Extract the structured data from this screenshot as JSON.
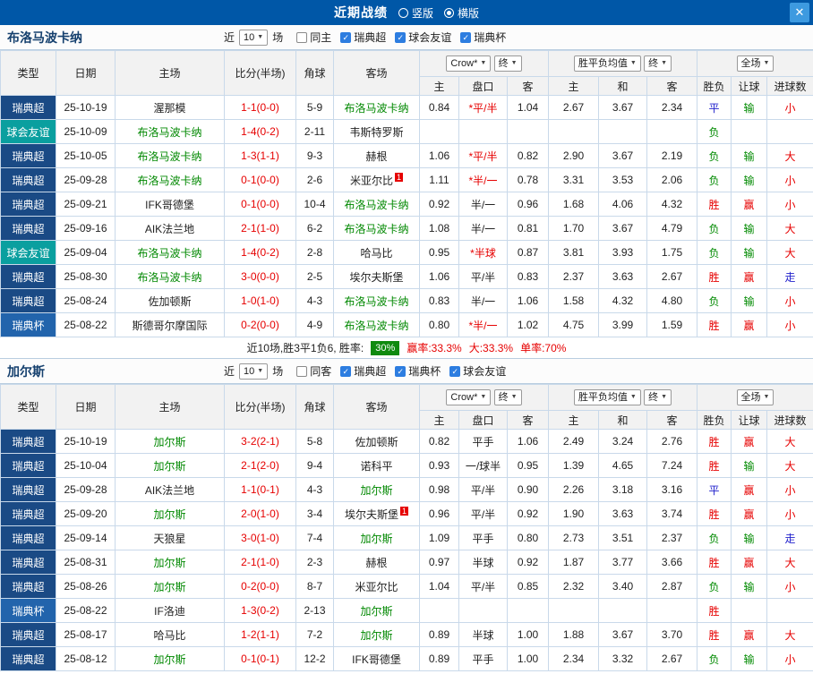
{
  "topbar": {
    "title": "近期战绩",
    "radio_vertical": "竖版",
    "radio_horizontal": "横版",
    "selected": "横版",
    "close_icon": "✕"
  },
  "table_headers": {
    "type": "类型",
    "date": "日期",
    "home": "主场",
    "score": "比分(半场)",
    "corner": "角球",
    "away": "客场",
    "odds_provider": "Crow*",
    "final": "终",
    "avg_label": "胜平负均值",
    "full_match": "全场",
    "sub": [
      "主",
      "盘口",
      "客",
      "主",
      "和",
      "客",
      "胜负",
      "让球",
      "进球数"
    ]
  },
  "colors": {
    "topbar_blue": "#0057a7",
    "league_navy": "#1a4a85",
    "friendly_teal": "#0a9f9f",
    "cup_blue": "#2264ac",
    "win_red": "#e60000",
    "lose_green": "#008a00",
    "draw_blue": "#2222cc",
    "badge_green": "#0f8a0f"
  },
  "sections": [
    {
      "team": "布洛马波卡纳",
      "near_label": "近",
      "games_count": "10",
      "games_label": "场",
      "filters": [
        {
          "label": "同主",
          "checked": false
        },
        {
          "label": "瑞典超",
          "checked": true
        },
        {
          "label": "球会友谊",
          "checked": true
        },
        {
          "label": "瑞典杯",
          "checked": true
        }
      ],
      "rows": [
        {
          "type": "瑞典超",
          "tc": "league",
          "date": "25-10-19",
          "home": "渥那模",
          "home_hl": false,
          "home_rc": false,
          "score": "1-1(0-0)",
          "corner": "5-9",
          "away": "布洛马波卡纳",
          "away_hl": true,
          "away_rc": false,
          "o": [
            "0.84",
            "*平/半",
            "1.04"
          ],
          "hcp_red": true,
          "avg": [
            "2.67",
            "3.67",
            "2.34"
          ],
          "res": [
            [
              "平",
              "blue"
            ],
            [
              "输",
              "green"
            ],
            [
              "小",
              "red"
            ]
          ]
        },
        {
          "type": "球会友谊",
          "tc": "friendly",
          "date": "25-10-09",
          "home": "布洛马波卡纳",
          "home_hl": true,
          "home_rc": false,
          "score": "1-4(0-2)",
          "corner": "2-11",
          "away": "韦斯特罗斯",
          "away_hl": false,
          "away_rc": false,
          "o": [
            "",
            "",
            ""
          ],
          "hcp_red": false,
          "avg": [
            "",
            "",
            ""
          ],
          "res": [
            [
              "负",
              "green"
            ],
            [
              "",
              ""
            ],
            [
              "",
              ""
            ]
          ]
        },
        {
          "type": "瑞典超",
          "tc": "league",
          "date": "25-10-05",
          "home": "布洛马波卡纳",
          "home_hl": true,
          "home_rc": false,
          "score": "1-3(1-1)",
          "corner": "9-3",
          "away": "赫根",
          "away_hl": false,
          "away_rc": false,
          "o": [
            "1.06",
            "*平/半",
            "0.82"
          ],
          "hcp_red": true,
          "avg": [
            "2.90",
            "3.67",
            "2.19"
          ],
          "res": [
            [
              "负",
              "green"
            ],
            [
              "输",
              "green"
            ],
            [
              "大",
              "red"
            ]
          ]
        },
        {
          "type": "瑞典超",
          "tc": "league",
          "date": "25-09-28",
          "home": "布洛马波卡纳",
          "home_hl": true,
          "home_rc": false,
          "score": "0-1(0-0)",
          "corner": "2-6",
          "away": "米亚尔比",
          "away_hl": false,
          "away_rc": true,
          "o": [
            "1.11",
            "*半/一",
            "0.78"
          ],
          "hcp_red": true,
          "avg": [
            "3.31",
            "3.53",
            "2.06"
          ],
          "res": [
            [
              "负",
              "green"
            ],
            [
              "输",
              "green"
            ],
            [
              "小",
              "red"
            ]
          ]
        },
        {
          "type": "瑞典超",
          "tc": "league",
          "date": "25-09-21",
          "home": "IFK哥德堡",
          "home_hl": false,
          "home_rc": false,
          "score": "0-1(0-0)",
          "corner": "10-4",
          "away": "布洛马波卡纳",
          "away_hl": true,
          "away_rc": false,
          "o": [
            "0.92",
            "半/一",
            "0.96"
          ],
          "hcp_red": false,
          "avg": [
            "1.68",
            "4.06",
            "4.32"
          ],
          "res": [
            [
              "胜",
              "red"
            ],
            [
              "赢",
              "red"
            ],
            [
              "小",
              "red"
            ]
          ]
        },
        {
          "type": "瑞典超",
          "tc": "league",
          "date": "25-09-16",
          "home": "AIK法兰地",
          "home_hl": false,
          "home_rc": false,
          "score": "2-1(1-0)",
          "corner": "6-2",
          "away": "布洛马波卡纳",
          "away_hl": true,
          "away_rc": false,
          "o": [
            "1.08",
            "半/一",
            "0.81"
          ],
          "hcp_red": false,
          "avg": [
            "1.70",
            "3.67",
            "4.79"
          ],
          "res": [
            [
              "负",
              "green"
            ],
            [
              "输",
              "green"
            ],
            [
              "大",
              "red"
            ]
          ]
        },
        {
          "type": "球会友谊",
          "tc": "friendly",
          "date": "25-09-04",
          "home": "布洛马波卡纳",
          "home_hl": true,
          "home_rc": false,
          "score": "1-4(0-2)",
          "corner": "2-8",
          "away": "哈马比",
          "away_hl": false,
          "away_rc": false,
          "o": [
            "0.95",
            "*半球",
            "0.87"
          ],
          "hcp_red": true,
          "avg": [
            "3.81",
            "3.93",
            "1.75"
          ],
          "res": [
            [
              "负",
              "green"
            ],
            [
              "输",
              "green"
            ],
            [
              "大",
              "red"
            ]
          ]
        },
        {
          "type": "瑞典超",
          "tc": "league",
          "date": "25-08-30",
          "home": "布洛马波卡纳",
          "home_hl": true,
          "home_rc": false,
          "score": "3-0(0-0)",
          "corner": "2-5",
          "away": "埃尔夫斯堡",
          "away_hl": false,
          "away_rc": false,
          "o": [
            "1.06",
            "平/半",
            "0.83"
          ],
          "hcp_red": false,
          "avg": [
            "2.37",
            "3.63",
            "2.67"
          ],
          "res": [
            [
              "胜",
              "red"
            ],
            [
              "赢",
              "red"
            ],
            [
              "走",
              "blue"
            ]
          ]
        },
        {
          "type": "瑞典超",
          "tc": "league",
          "date": "25-08-24",
          "home": "佐加顿斯",
          "home_hl": false,
          "home_rc": false,
          "score": "1-0(1-0)",
          "corner": "4-3",
          "away": "布洛马波卡纳",
          "away_hl": true,
          "away_rc": false,
          "o": [
            "0.83",
            "半/一",
            "1.06"
          ],
          "hcp_red": false,
          "avg": [
            "1.58",
            "4.32",
            "4.80"
          ],
          "res": [
            [
              "负",
              "green"
            ],
            [
              "输",
              "green"
            ],
            [
              "小",
              "red"
            ]
          ]
        },
        {
          "type": "瑞典杯",
          "tc": "cup",
          "date": "25-08-22",
          "home": "斯德哥尔摩国际",
          "home_hl": false,
          "home_rc": false,
          "score": "0-2(0-0)",
          "corner": "4-9",
          "away": "布洛马波卡纳",
          "away_hl": true,
          "away_rc": false,
          "o": [
            "0.80",
            "*半/一",
            "1.02"
          ],
          "hcp_red": true,
          "avg": [
            "4.75",
            "3.99",
            "1.59"
          ],
          "res": [
            [
              "胜",
              "red"
            ],
            [
              "赢",
              "red"
            ],
            [
              "小",
              "red"
            ]
          ]
        }
      ],
      "summary": {
        "record": "近10场,胜3平1负6, 胜率:",
        "win_rate": "30%",
        "stats": [
          "赢率:33.3%",
          "大:33.3%",
          "单率:70%"
        ]
      }
    },
    {
      "team": "加尔斯",
      "near_label": "近",
      "games_count": "10",
      "games_label": "场",
      "filters": [
        {
          "label": "同客",
          "checked": false
        },
        {
          "label": "瑞典超",
          "checked": true
        },
        {
          "label": "瑞典杯",
          "checked": true
        },
        {
          "label": "球会友谊",
          "checked": true
        }
      ],
      "rows": [
        {
          "type": "瑞典超",
          "tc": "league",
          "date": "25-10-19",
          "home": "加尔斯",
          "home_hl": true,
          "home_rc": false,
          "score": "3-2(2-1)",
          "corner": "5-8",
          "away": "佐加顿斯",
          "away_hl": false,
          "away_rc": false,
          "o": [
            "0.82",
            "平手",
            "1.06"
          ],
          "hcp_red": false,
          "avg": [
            "2.49",
            "3.24",
            "2.76"
          ],
          "res": [
            [
              "胜",
              "red"
            ],
            [
              "赢",
              "red"
            ],
            [
              "大",
              "red"
            ]
          ]
        },
        {
          "type": "瑞典超",
          "tc": "league",
          "date": "25-10-04",
          "home": "加尔斯",
          "home_hl": true,
          "home_rc": false,
          "score": "2-1(2-0)",
          "corner": "9-4",
          "away": "诺科平",
          "away_hl": false,
          "away_rc": false,
          "o": [
            "0.93",
            "一/球半",
            "0.95"
          ],
          "hcp_red": false,
          "avg": [
            "1.39",
            "4.65",
            "7.24"
          ],
          "res": [
            [
              "胜",
              "red"
            ],
            [
              "输",
              "green"
            ],
            [
              "大",
              "red"
            ]
          ]
        },
        {
          "type": "瑞典超",
          "tc": "league",
          "date": "25-09-28",
          "home": "AIK法兰地",
          "home_hl": false,
          "home_rc": false,
          "score": "1-1(0-1)",
          "corner": "4-3",
          "away": "加尔斯",
          "away_hl": true,
          "away_rc": false,
          "o": [
            "0.98",
            "平/半",
            "0.90"
          ],
          "hcp_red": false,
          "avg": [
            "2.26",
            "3.18",
            "3.16"
          ],
          "res": [
            [
              "平",
              "blue"
            ],
            [
              "赢",
              "red"
            ],
            [
              "小",
              "red"
            ]
          ]
        },
        {
          "type": "瑞典超",
          "tc": "league",
          "date": "25-09-20",
          "home": "加尔斯",
          "home_hl": true,
          "home_rc": false,
          "score": "2-0(1-0)",
          "corner": "3-4",
          "away": "埃尔夫斯堡",
          "away_hl": false,
          "away_rc": true,
          "o": [
            "0.96",
            "平/半",
            "0.92"
          ],
          "hcp_red": false,
          "avg": [
            "1.90",
            "3.63",
            "3.74"
          ],
          "res": [
            [
              "胜",
              "red"
            ],
            [
              "赢",
              "red"
            ],
            [
              "小",
              "red"
            ]
          ]
        },
        {
          "type": "瑞典超",
          "tc": "league",
          "date": "25-09-14",
          "home": "天狼星",
          "home_hl": false,
          "home_rc": false,
          "score": "3-0(1-0)",
          "corner": "7-4",
          "away": "加尔斯",
          "away_hl": true,
          "away_rc": false,
          "o": [
            "1.09",
            "平手",
            "0.80"
          ],
          "hcp_red": false,
          "avg": [
            "2.73",
            "3.51",
            "2.37"
          ],
          "res": [
            [
              "负",
              "green"
            ],
            [
              "输",
              "green"
            ],
            [
              "走",
              "blue"
            ]
          ]
        },
        {
          "type": "瑞典超",
          "tc": "league",
          "date": "25-08-31",
          "home": "加尔斯",
          "home_hl": true,
          "home_rc": false,
          "score": "2-1(1-0)",
          "corner": "2-3",
          "away": "赫根",
          "away_hl": false,
          "away_rc": false,
          "o": [
            "0.97",
            "半球",
            "0.92"
          ],
          "hcp_red": false,
          "avg": [
            "1.87",
            "3.77",
            "3.66"
          ],
          "res": [
            [
              "胜",
              "red"
            ],
            [
              "赢",
              "red"
            ],
            [
              "大",
              "red"
            ]
          ]
        },
        {
          "type": "瑞典超",
          "tc": "league",
          "date": "25-08-26",
          "home": "加尔斯",
          "home_hl": true,
          "home_rc": false,
          "score": "0-2(0-0)",
          "corner": "8-7",
          "away": "米亚尔比",
          "away_hl": false,
          "away_rc": false,
          "o": [
            "1.04",
            "平/半",
            "0.85"
          ],
          "hcp_red": false,
          "avg": [
            "2.32",
            "3.40",
            "2.87"
          ],
          "res": [
            [
              "负",
              "green"
            ],
            [
              "输",
              "green"
            ],
            [
              "小",
              "red"
            ]
          ]
        },
        {
          "type": "瑞典杯",
          "tc": "cup",
          "date": "25-08-22",
          "home": "IF洛迪",
          "home_hl": false,
          "home_rc": false,
          "score": "1-3(0-2)",
          "corner": "2-13",
          "away": "加尔斯",
          "away_hl": true,
          "away_rc": false,
          "o": [
            "",
            "",
            ""
          ],
          "hcp_red": false,
          "avg": [
            "",
            "",
            ""
          ],
          "res": [
            [
              "胜",
              "red"
            ],
            [
              "",
              ""
            ],
            [
              "",
              ""
            ]
          ]
        },
        {
          "type": "瑞典超",
          "tc": "league",
          "date": "25-08-17",
          "home": "哈马比",
          "home_hl": false,
          "home_rc": false,
          "score": "1-2(1-1)",
          "corner": "7-2",
          "away": "加尔斯",
          "away_hl": true,
          "away_rc": false,
          "o": [
            "0.89",
            "半球",
            "1.00"
          ],
          "hcp_red": false,
          "avg": [
            "1.88",
            "3.67",
            "3.70"
          ],
          "res": [
            [
              "胜",
              "red"
            ],
            [
              "赢",
              "red"
            ],
            [
              "大",
              "red"
            ]
          ]
        },
        {
          "type": "瑞典超",
          "tc": "league",
          "date": "25-08-12",
          "home": "加尔斯",
          "home_hl": true,
          "home_rc": false,
          "score": "0-1(0-1)",
          "corner": "12-2",
          "away": "IFK哥德堡",
          "away_hl": false,
          "away_rc": false,
          "o": [
            "0.89",
            "平手",
            "1.00"
          ],
          "hcp_red": false,
          "avg": [
            "2.34",
            "3.32",
            "2.67"
          ],
          "res": [
            [
              "负",
              "green"
            ],
            [
              "输",
              "green"
            ],
            [
              "小",
              "red"
            ]
          ]
        }
      ]
    }
  ]
}
